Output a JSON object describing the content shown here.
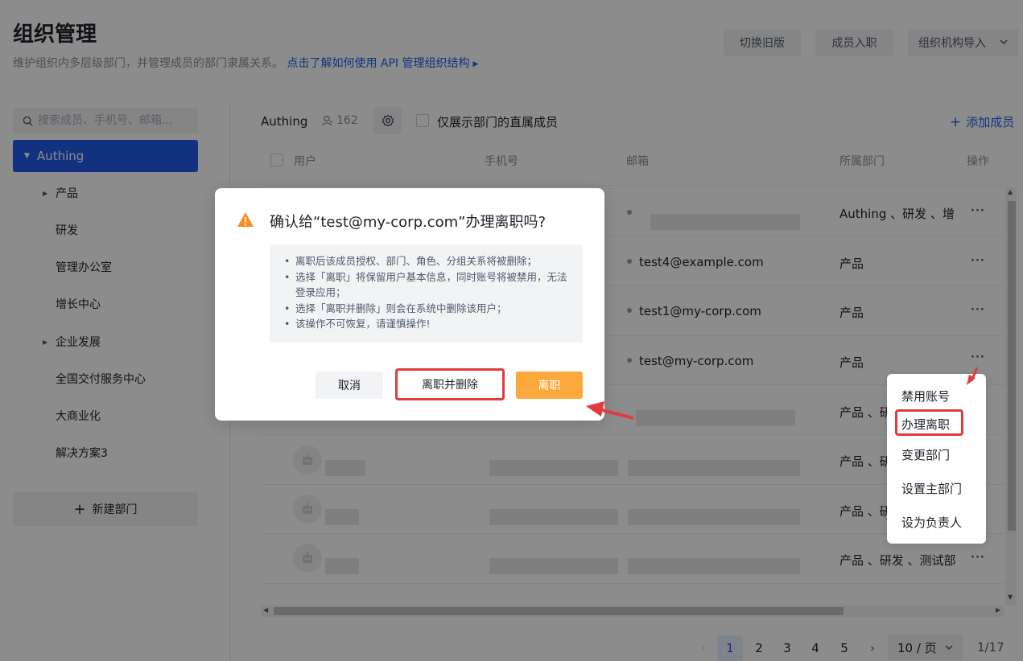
{
  "header": {
    "title": "组织管理",
    "description": "维护组织内多层级部门，并管理成员的部门隶属关系。",
    "doc_link": "点击了解如何使用 API 管理组织结构",
    "switch_old_label": "切换旧版",
    "onboard_label": "成员入职",
    "import_label": "组织机构导入"
  },
  "sidebar": {
    "search_placeholder": "搜索成员、手机号、邮箱...",
    "root": "Authing",
    "items": [
      {
        "label": "产品",
        "expandable": true
      },
      {
        "label": "研发",
        "expandable": false
      },
      {
        "label": "管理办公室",
        "expandable": false
      },
      {
        "label": "增长中心",
        "expandable": false
      },
      {
        "label": "企业发展",
        "expandable": true
      },
      {
        "label": "全国交付服务中心",
        "expandable": false
      },
      {
        "label": "大商业化",
        "expandable": false
      },
      {
        "label": "解决方案3",
        "expandable": false
      }
    ],
    "new_dept_label": "新建部门"
  },
  "toolbar": {
    "org_name": "Authing",
    "member_count": "162",
    "direct_only_label": "仅展示部门的直属成员",
    "add_member_label": "添加成员"
  },
  "table": {
    "columns": [
      "用户",
      "手机号",
      "邮箱",
      "所属部门",
      "操作"
    ],
    "rows": [
      {
        "email": "",
        "dept": "Authing 、研发 、增"
      },
      {
        "email": "test4@example.com",
        "dept": "产品"
      },
      {
        "email": "test1@my-corp.com",
        "dept": "产品"
      },
      {
        "email": "test@my-corp.com",
        "dept": "产品"
      },
      {
        "email": "",
        "dept": "产品 、研"
      },
      {
        "email": "",
        "dept": "产品 、研"
      },
      {
        "email": "",
        "dept": "产品 、研"
      },
      {
        "email": "",
        "dept": "产品 、研发 、测试部"
      }
    ],
    "more_label": "···"
  },
  "pagination": {
    "pages": [
      "1",
      "2",
      "3",
      "4",
      "5"
    ],
    "current": "1",
    "page_size": "10 / 页",
    "total": "1/17"
  },
  "action_menu": {
    "items": [
      "禁用账号",
      "办理离职",
      "变更部门",
      "设置主部门",
      "设为负责人"
    ]
  },
  "dialog": {
    "title": "确认给“test@my-corp.com”办理离职吗?",
    "notes": [
      "离职后该成员授权、部门、角色、分组关系将被删除；",
      "选择「离职」将保留用户基本信息，同时账号将被禁用，无法登录应用；",
      "选择「离职并删除」则会在系统中删除该用户；",
      "该操作不可恢复，请谨慎操作!"
    ],
    "cancel_label": "取消",
    "resign_delete_label": "离职并删除",
    "resign_label": "离职"
  },
  "colors": {
    "primary": "#215ae5",
    "warning": "#fba83c",
    "highlight": "#e23b3b"
  }
}
